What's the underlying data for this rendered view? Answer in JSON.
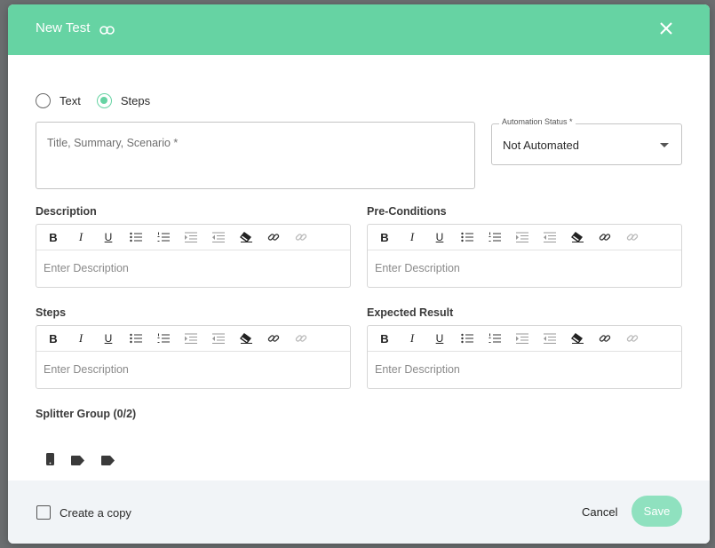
{
  "header": {
    "title": "New Test",
    "link_icon": "link-icon",
    "close_icon": "close-icon",
    "color": "#66d3a3"
  },
  "mode": {
    "options": [
      {
        "label": "Text",
        "checked": false
      },
      {
        "label": "Steps",
        "checked": true
      }
    ]
  },
  "title_field": {
    "placeholder": "Title, Summary, Scenario *"
  },
  "automation_status": {
    "label": "Automation Status *",
    "value": "Not Automated"
  },
  "editors": [
    {
      "label": "Description",
      "placeholder": "Enter Description"
    },
    {
      "label": "Pre-Conditions",
      "placeholder": "Enter Description"
    },
    {
      "label": "Steps",
      "placeholder": "Enter Description"
    },
    {
      "label": "Expected Result",
      "placeholder": "Enter Description"
    }
  ],
  "toolbar": {
    "bold": "B",
    "italic": "I",
    "underline": "U",
    "icons": [
      "bullet-list-icon",
      "numbered-list-icon",
      "indent-icon",
      "outdent-icon",
      "eraser-icon",
      "link-icon",
      "unlink-icon"
    ]
  },
  "splitter": {
    "label": "Splitter Group (0/2)",
    "icons": [
      "mobile-icon",
      "tag-icon",
      "tag-icon"
    ]
  },
  "footer": {
    "copy_label": "Create a copy",
    "cancel_label": "Cancel",
    "save_label": "Save",
    "save_color": "#8fe1bf"
  }
}
